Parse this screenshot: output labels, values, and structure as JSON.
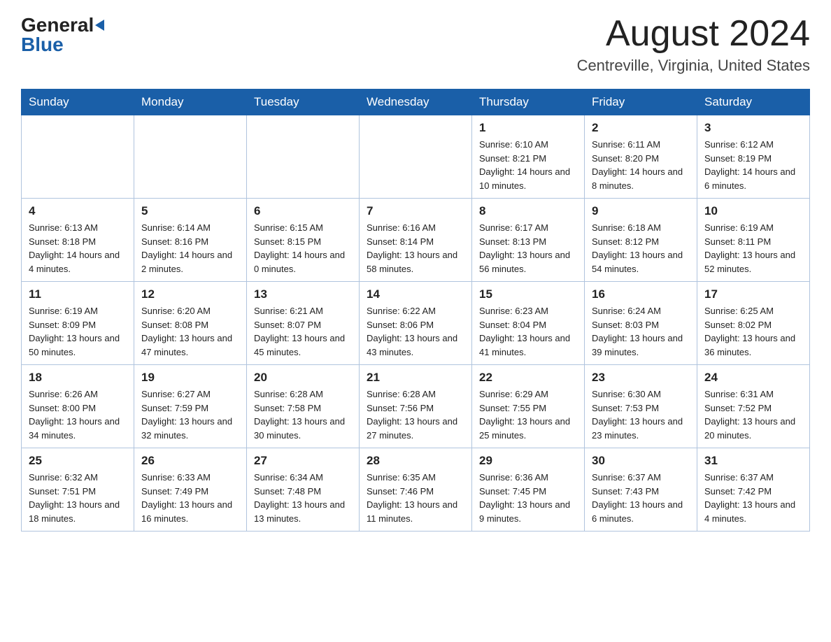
{
  "header": {
    "logo_general": "General",
    "logo_blue": "Blue",
    "month_year": "August 2024",
    "location": "Centreville, Virginia, United States"
  },
  "days_of_week": [
    "Sunday",
    "Monday",
    "Tuesday",
    "Wednesday",
    "Thursday",
    "Friday",
    "Saturday"
  ],
  "weeks": [
    [
      {
        "day": "",
        "info": ""
      },
      {
        "day": "",
        "info": ""
      },
      {
        "day": "",
        "info": ""
      },
      {
        "day": "",
        "info": ""
      },
      {
        "day": "1",
        "info": "Sunrise: 6:10 AM\nSunset: 8:21 PM\nDaylight: 14 hours and 10 minutes."
      },
      {
        "day": "2",
        "info": "Sunrise: 6:11 AM\nSunset: 8:20 PM\nDaylight: 14 hours and 8 minutes."
      },
      {
        "day": "3",
        "info": "Sunrise: 6:12 AM\nSunset: 8:19 PM\nDaylight: 14 hours and 6 minutes."
      }
    ],
    [
      {
        "day": "4",
        "info": "Sunrise: 6:13 AM\nSunset: 8:18 PM\nDaylight: 14 hours and 4 minutes."
      },
      {
        "day": "5",
        "info": "Sunrise: 6:14 AM\nSunset: 8:16 PM\nDaylight: 14 hours and 2 minutes."
      },
      {
        "day": "6",
        "info": "Sunrise: 6:15 AM\nSunset: 8:15 PM\nDaylight: 14 hours and 0 minutes."
      },
      {
        "day": "7",
        "info": "Sunrise: 6:16 AM\nSunset: 8:14 PM\nDaylight: 13 hours and 58 minutes."
      },
      {
        "day": "8",
        "info": "Sunrise: 6:17 AM\nSunset: 8:13 PM\nDaylight: 13 hours and 56 minutes."
      },
      {
        "day": "9",
        "info": "Sunrise: 6:18 AM\nSunset: 8:12 PM\nDaylight: 13 hours and 54 minutes."
      },
      {
        "day": "10",
        "info": "Sunrise: 6:19 AM\nSunset: 8:11 PM\nDaylight: 13 hours and 52 minutes."
      }
    ],
    [
      {
        "day": "11",
        "info": "Sunrise: 6:19 AM\nSunset: 8:09 PM\nDaylight: 13 hours and 50 minutes."
      },
      {
        "day": "12",
        "info": "Sunrise: 6:20 AM\nSunset: 8:08 PM\nDaylight: 13 hours and 47 minutes."
      },
      {
        "day": "13",
        "info": "Sunrise: 6:21 AM\nSunset: 8:07 PM\nDaylight: 13 hours and 45 minutes."
      },
      {
        "day": "14",
        "info": "Sunrise: 6:22 AM\nSunset: 8:06 PM\nDaylight: 13 hours and 43 minutes."
      },
      {
        "day": "15",
        "info": "Sunrise: 6:23 AM\nSunset: 8:04 PM\nDaylight: 13 hours and 41 minutes."
      },
      {
        "day": "16",
        "info": "Sunrise: 6:24 AM\nSunset: 8:03 PM\nDaylight: 13 hours and 39 minutes."
      },
      {
        "day": "17",
        "info": "Sunrise: 6:25 AM\nSunset: 8:02 PM\nDaylight: 13 hours and 36 minutes."
      }
    ],
    [
      {
        "day": "18",
        "info": "Sunrise: 6:26 AM\nSunset: 8:00 PM\nDaylight: 13 hours and 34 minutes."
      },
      {
        "day": "19",
        "info": "Sunrise: 6:27 AM\nSunset: 7:59 PM\nDaylight: 13 hours and 32 minutes."
      },
      {
        "day": "20",
        "info": "Sunrise: 6:28 AM\nSunset: 7:58 PM\nDaylight: 13 hours and 30 minutes."
      },
      {
        "day": "21",
        "info": "Sunrise: 6:28 AM\nSunset: 7:56 PM\nDaylight: 13 hours and 27 minutes."
      },
      {
        "day": "22",
        "info": "Sunrise: 6:29 AM\nSunset: 7:55 PM\nDaylight: 13 hours and 25 minutes."
      },
      {
        "day": "23",
        "info": "Sunrise: 6:30 AM\nSunset: 7:53 PM\nDaylight: 13 hours and 23 minutes."
      },
      {
        "day": "24",
        "info": "Sunrise: 6:31 AM\nSunset: 7:52 PM\nDaylight: 13 hours and 20 minutes."
      }
    ],
    [
      {
        "day": "25",
        "info": "Sunrise: 6:32 AM\nSunset: 7:51 PM\nDaylight: 13 hours and 18 minutes."
      },
      {
        "day": "26",
        "info": "Sunrise: 6:33 AM\nSunset: 7:49 PM\nDaylight: 13 hours and 16 minutes."
      },
      {
        "day": "27",
        "info": "Sunrise: 6:34 AM\nSunset: 7:48 PM\nDaylight: 13 hours and 13 minutes."
      },
      {
        "day": "28",
        "info": "Sunrise: 6:35 AM\nSunset: 7:46 PM\nDaylight: 13 hours and 11 minutes."
      },
      {
        "day": "29",
        "info": "Sunrise: 6:36 AM\nSunset: 7:45 PM\nDaylight: 13 hours and 9 minutes."
      },
      {
        "day": "30",
        "info": "Sunrise: 6:37 AM\nSunset: 7:43 PM\nDaylight: 13 hours and 6 minutes."
      },
      {
        "day": "31",
        "info": "Sunrise: 6:37 AM\nSunset: 7:42 PM\nDaylight: 13 hours and 4 minutes."
      }
    ]
  ]
}
